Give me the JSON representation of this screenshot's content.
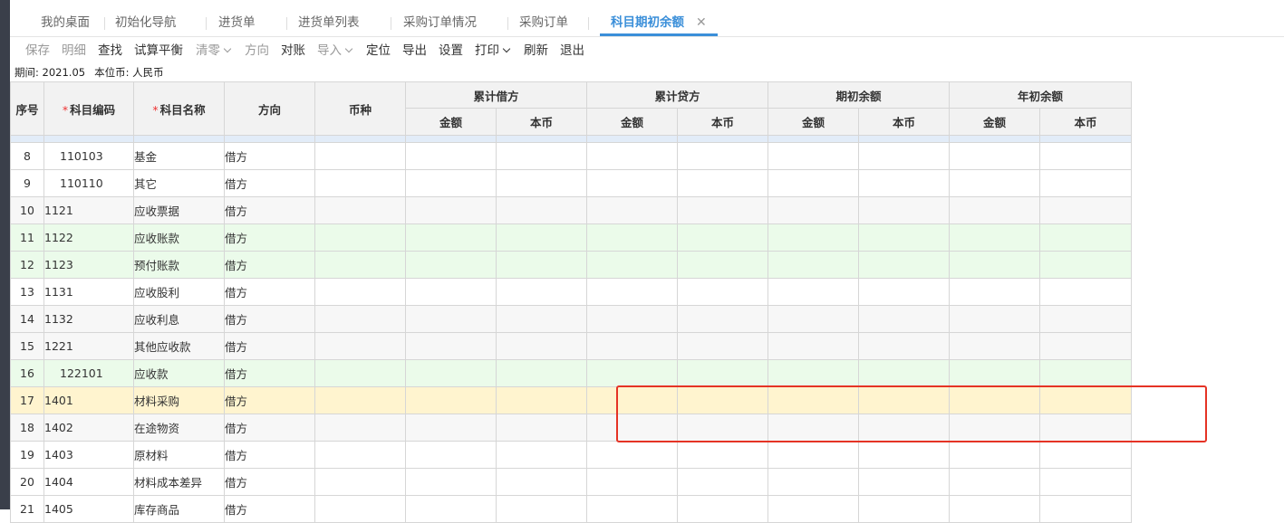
{
  "tabs": [
    {
      "label": "我的桌面"
    },
    {
      "label": "初始化导航"
    },
    {
      "label": "进货单"
    },
    {
      "label": "进货单列表"
    },
    {
      "label": "采购订单情况"
    },
    {
      "label": "采购订单"
    },
    {
      "label": "科目期初余额",
      "active": true
    }
  ],
  "toolbar": {
    "save": "保存",
    "detail": "明细",
    "find": "查找",
    "trial_balance": "试算平衡",
    "clear": "清零",
    "direction": "方向",
    "reconcile": "对账",
    "import": "导入",
    "locate": "定位",
    "export": "导出",
    "settings": "设置",
    "print": "打印",
    "refresh": "刷新",
    "exit": "退出"
  },
  "info": {
    "period": "期间: 2021.05",
    "currency": "本位币: 人民币"
  },
  "table": {
    "headers": {
      "index": "序号",
      "required_mark": "*",
      "code": "科目编码",
      "name": "科目名称",
      "direction": "方向",
      "currency": "币种",
      "cum_debit": "累计借方",
      "cum_credit": "累计贷方",
      "opening": "期初余额",
      "year_opening": "年初余额",
      "amount": "金额",
      "local": "本币"
    },
    "rows": [
      {
        "idx": "8",
        "code": "110103",
        "name": "基金",
        "dir": "借方"
      },
      {
        "idx": "9",
        "code": "110110",
        "name": "其它",
        "dir": "借方"
      },
      {
        "idx": "10",
        "code": "1121",
        "name": "应收票据",
        "dir": "借方"
      },
      {
        "idx": "11",
        "code": "1122",
        "name": "应收账款",
        "dir": "借方"
      },
      {
        "idx": "12",
        "code": "1123",
        "name": "预付账款",
        "dir": "借方"
      },
      {
        "idx": "13",
        "code": "1131",
        "name": "应收股利",
        "dir": "借方"
      },
      {
        "idx": "14",
        "code": "1132",
        "name": "应收利息",
        "dir": "借方"
      },
      {
        "idx": "15",
        "code": "1221",
        "name": "其他应收款",
        "dir": "借方"
      },
      {
        "idx": "16",
        "code": "122101",
        "name": "应收款",
        "dir": "借方"
      },
      {
        "idx": "17",
        "code": "1401",
        "name": "材料采购",
        "dir": "借方"
      },
      {
        "idx": "18",
        "code": "1402",
        "name": "在途物资",
        "dir": "借方"
      },
      {
        "idx": "19",
        "code": "1403",
        "name": "原材料",
        "dir": "借方"
      },
      {
        "idx": "20",
        "code": "1404",
        "name": "材料成本差异",
        "dir": "借方"
      },
      {
        "idx": "21",
        "code": "1405",
        "name": "库存商品",
        "dir": "借方"
      }
    ]
  },
  "colors": {
    "accent": "#3b8fd9",
    "row_green": "#ebfbea",
    "row_yellow": "#fff4cf",
    "highlight_box": "#e53325"
  }
}
